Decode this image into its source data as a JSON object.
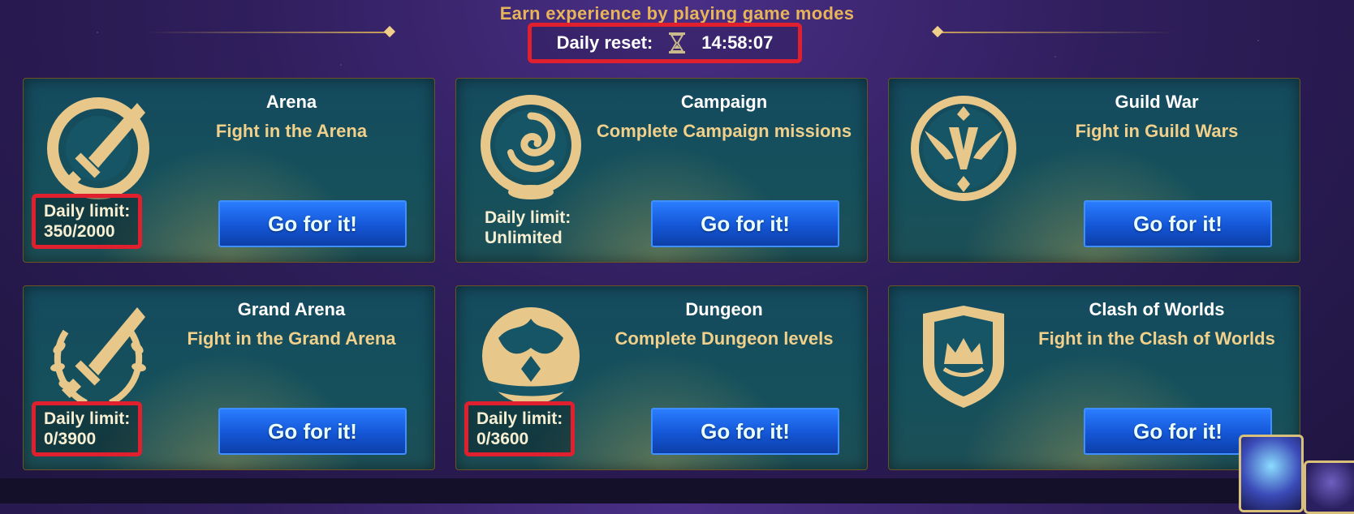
{
  "header": {
    "title": "Earn experience by playing game modes",
    "reset_label": "Daily reset:",
    "reset_time": "14:58:07"
  },
  "cards": [
    {
      "title": "Arena",
      "desc": "Fight in the Arena",
      "limit_label": "Daily limit:",
      "limit_value": "350/2000",
      "button": "Go for it!",
      "icon": "sword-shield-icon"
    },
    {
      "title": "Campaign",
      "desc": "Complete Campaign missions",
      "limit_label": "Daily limit:",
      "limit_value": "Unlimited",
      "button": "Go for it!",
      "icon": "swirl-medallion-icon"
    },
    {
      "title": "Guild War",
      "desc": "Fight in Guild Wars",
      "limit_label": "",
      "limit_value": "",
      "button": "Go for it!",
      "icon": "winged-v-emblem-icon"
    },
    {
      "title": "Grand Arena",
      "desc": "Fight in the Grand Arena",
      "limit_label": "Daily limit:",
      "limit_value": "0/3900",
      "button": "Go for it!",
      "icon": "laurel-sword-icon"
    },
    {
      "title": "Dungeon",
      "desc": "Complete Dungeon levels",
      "limit_label": "Daily limit:",
      "limit_value": "0/3600",
      "button": "Go for it!",
      "icon": "dungeon-gate-icon"
    },
    {
      "title": "Clash of Worlds",
      "desc": "Fight in the Clash of Worlds",
      "limit_label": "",
      "limit_value": "",
      "button": "Go for it!",
      "icon": "crown-shield-icon"
    }
  ],
  "colors": {
    "highlight": "#e0202e",
    "gold": "#e7b45a",
    "button_blue": "#1456d6"
  }
}
